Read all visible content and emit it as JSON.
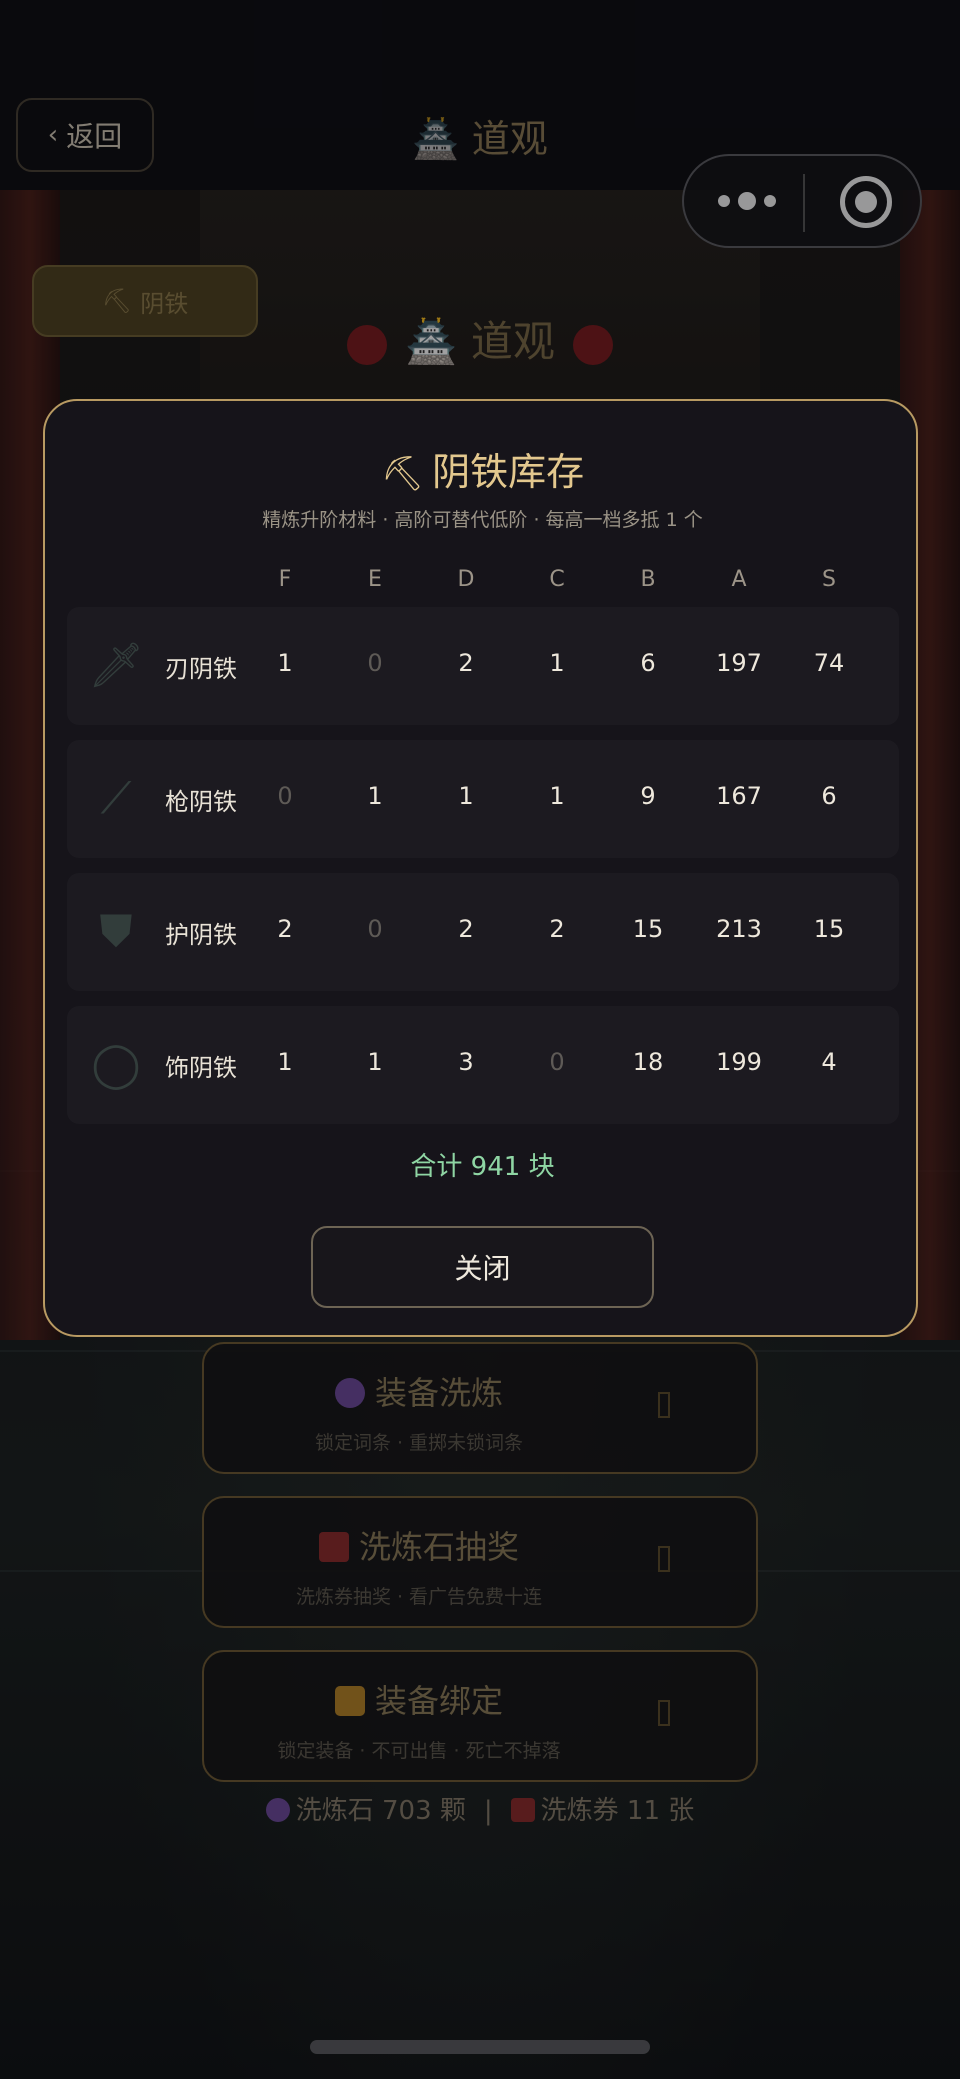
{
  "header": {
    "back_label": "返回",
    "title": "道观",
    "title_icon": "pagoda-icon"
  },
  "scene": {
    "tag_label": "阴铁",
    "tag_icon": "pickaxe-icon",
    "title": "道观"
  },
  "menu_cards": [
    {
      "title": "装备洗炼",
      "subtitle": "锁定词条 · 重掷未锁词条",
      "icon": "crystal-ball-icon"
    },
    {
      "title": "洗炼石抽奖",
      "subtitle": "洗炼券抽奖 · 看广告免费十连",
      "icon": "ticket-icon"
    },
    {
      "title": "装备绑定",
      "subtitle": "锁定装备 · 不可出售 · 死亡不掉落",
      "icon": "lock-icon"
    }
  ],
  "footer": {
    "stones_label": "洗炼石 703 颗",
    "separator": "|",
    "tickets_label": "洗炼券 11 张"
  },
  "modal": {
    "title": "阴铁库存",
    "title_icon": "pickaxe-icon",
    "subtitle": "精炼升阶材料 · 高阶可替代低阶 · 每高一档多抵 1 个",
    "grades": [
      "F",
      "E",
      "D",
      "C",
      "B",
      "A",
      "S"
    ],
    "rows": [
      {
        "label": "刃阴铁",
        "icon": "blade-icon",
        "values": [
          "1",
          "0",
          "2",
          "1",
          "6",
          "197",
          "74"
        ]
      },
      {
        "label": "枪阴铁",
        "icon": "spear-icon",
        "values": [
          "0",
          "1",
          "1",
          "1",
          "9",
          "167",
          "6"
        ]
      },
      {
        "label": "护阴铁",
        "icon": "shield-icon",
        "values": [
          "2",
          "0",
          "2",
          "2",
          "15",
          "213",
          "15"
        ]
      },
      {
        "label": "饰阴铁",
        "icon": "ring-icon",
        "values": [
          "1",
          "1",
          "3",
          "0",
          "18",
          "199",
          "4"
        ]
      }
    ],
    "total": "合计 941 块",
    "close_label": "关闭"
  },
  "colors": {
    "accent_gold": "#e3c88e",
    "total_green": "#8fd6a4",
    "modal_border": "#b89a62"
  }
}
